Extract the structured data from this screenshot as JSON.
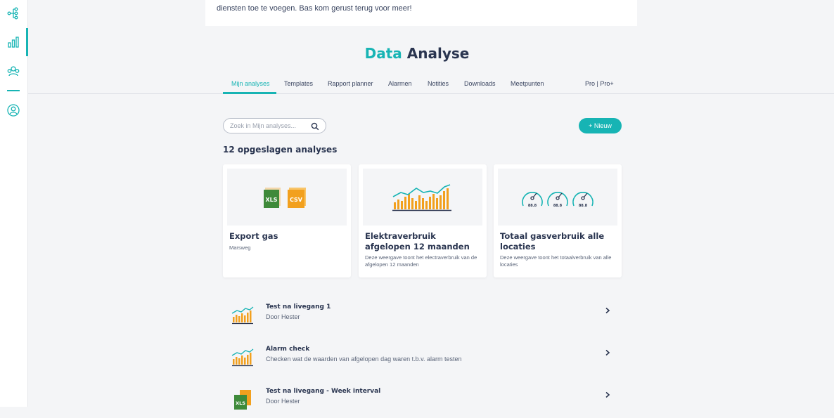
{
  "banner": {
    "text": "diensten toe te voegen. Bas kom gerust terug voor meer!"
  },
  "title": {
    "part1": "Data",
    "part2": " Analyse"
  },
  "tabs": [
    {
      "label": "Mijn analyses",
      "active": true
    },
    {
      "label": "Templates"
    },
    {
      "label": "Rapport planner"
    },
    {
      "label": "Alarmen"
    },
    {
      "label": "Notities"
    },
    {
      "label": "Downloads"
    },
    {
      "label": "Meetpunten"
    },
    {
      "label": "Pro | Pro+"
    }
  ],
  "search": {
    "placeholder": "Zoek in Mijn analyses..."
  },
  "new_button": "+ Nieuw",
  "count_title": "12 opgeslagen analyses",
  "cards": [
    {
      "title": "Export gas",
      "subtitle": "Marsweg",
      "icon": "xls-csv-icon"
    },
    {
      "title": "Elektraverbruik afgelopen 12 maanden",
      "subtitle": "Deze weergave toont het electraverbruik van de afgelopen 12 maanden",
      "icon": "bar-line-chart-icon"
    },
    {
      "title": "Totaal gasverbruik alle locaties",
      "subtitle": "Deze weergave toont het totaalverbruik van alle locaties",
      "icon": "gauge-icon",
      "gauge_label": "88.8"
    }
  ],
  "list": [
    {
      "title": "Test na livegang 1",
      "subtitle": "Door Hester",
      "icon": "chart-icon"
    },
    {
      "title": "Alarm check",
      "subtitle": "Checken wat de waarden van afgelopen dag waren t.b.v. alarm testen",
      "icon": "chart-icon"
    },
    {
      "title": "Test na livegang - Week interval",
      "subtitle": "Door Hester",
      "icon": "xls-icon"
    }
  ],
  "xls_label": "XLS",
  "csv_label": "CSV",
  "colors": {
    "accent": "#17b4b4",
    "navy": "#2a3550",
    "orange": "#f2a01e",
    "green": "#3e8a3a"
  }
}
